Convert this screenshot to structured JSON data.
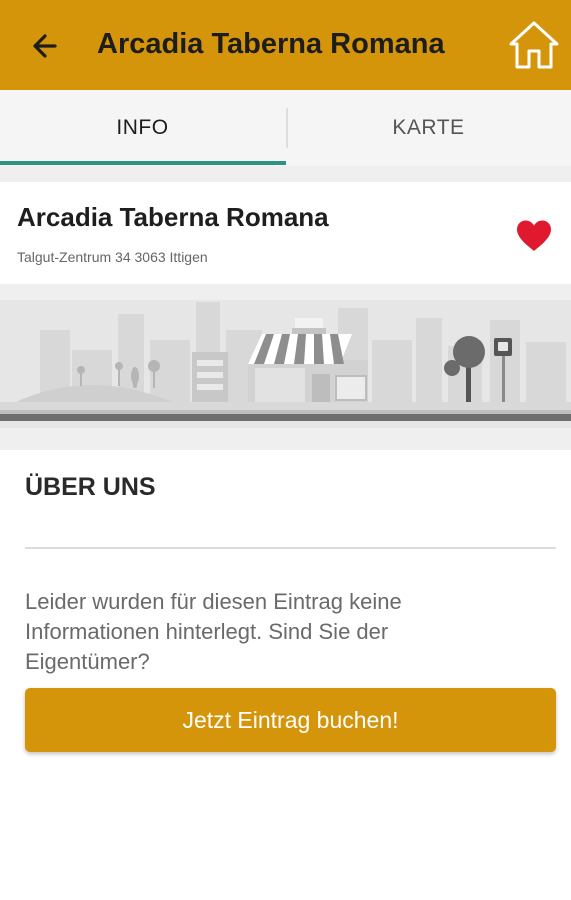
{
  "colors": {
    "appbar": "#d4950a",
    "tab_indicator": "#2e9480",
    "favorite": "#e0192f",
    "cta": "#d4950a"
  },
  "appbar": {
    "title": "Arcadia Taberna Romana",
    "back_icon": "arrow-left-icon",
    "home_icon": "home-icon"
  },
  "tabs": [
    {
      "label": "INFO",
      "active": true
    },
    {
      "label": "KARTE",
      "active": false
    }
  ],
  "place": {
    "name": "Arcadia Taberna Romana",
    "address": "Talgut-Zentrum 34 3063 Ittigen",
    "favorite_icon": "heart-icon",
    "favorited": true
  },
  "banner": {
    "illustration": "city-street-illustration"
  },
  "about": {
    "title": "ÜBER UNS",
    "text": "Leider wurden für diesen Eintrag keine Informationen hinterlegt. Sind Sie der Eigentümer?",
    "button_label": "Jetzt Eintrag buchen!"
  }
}
